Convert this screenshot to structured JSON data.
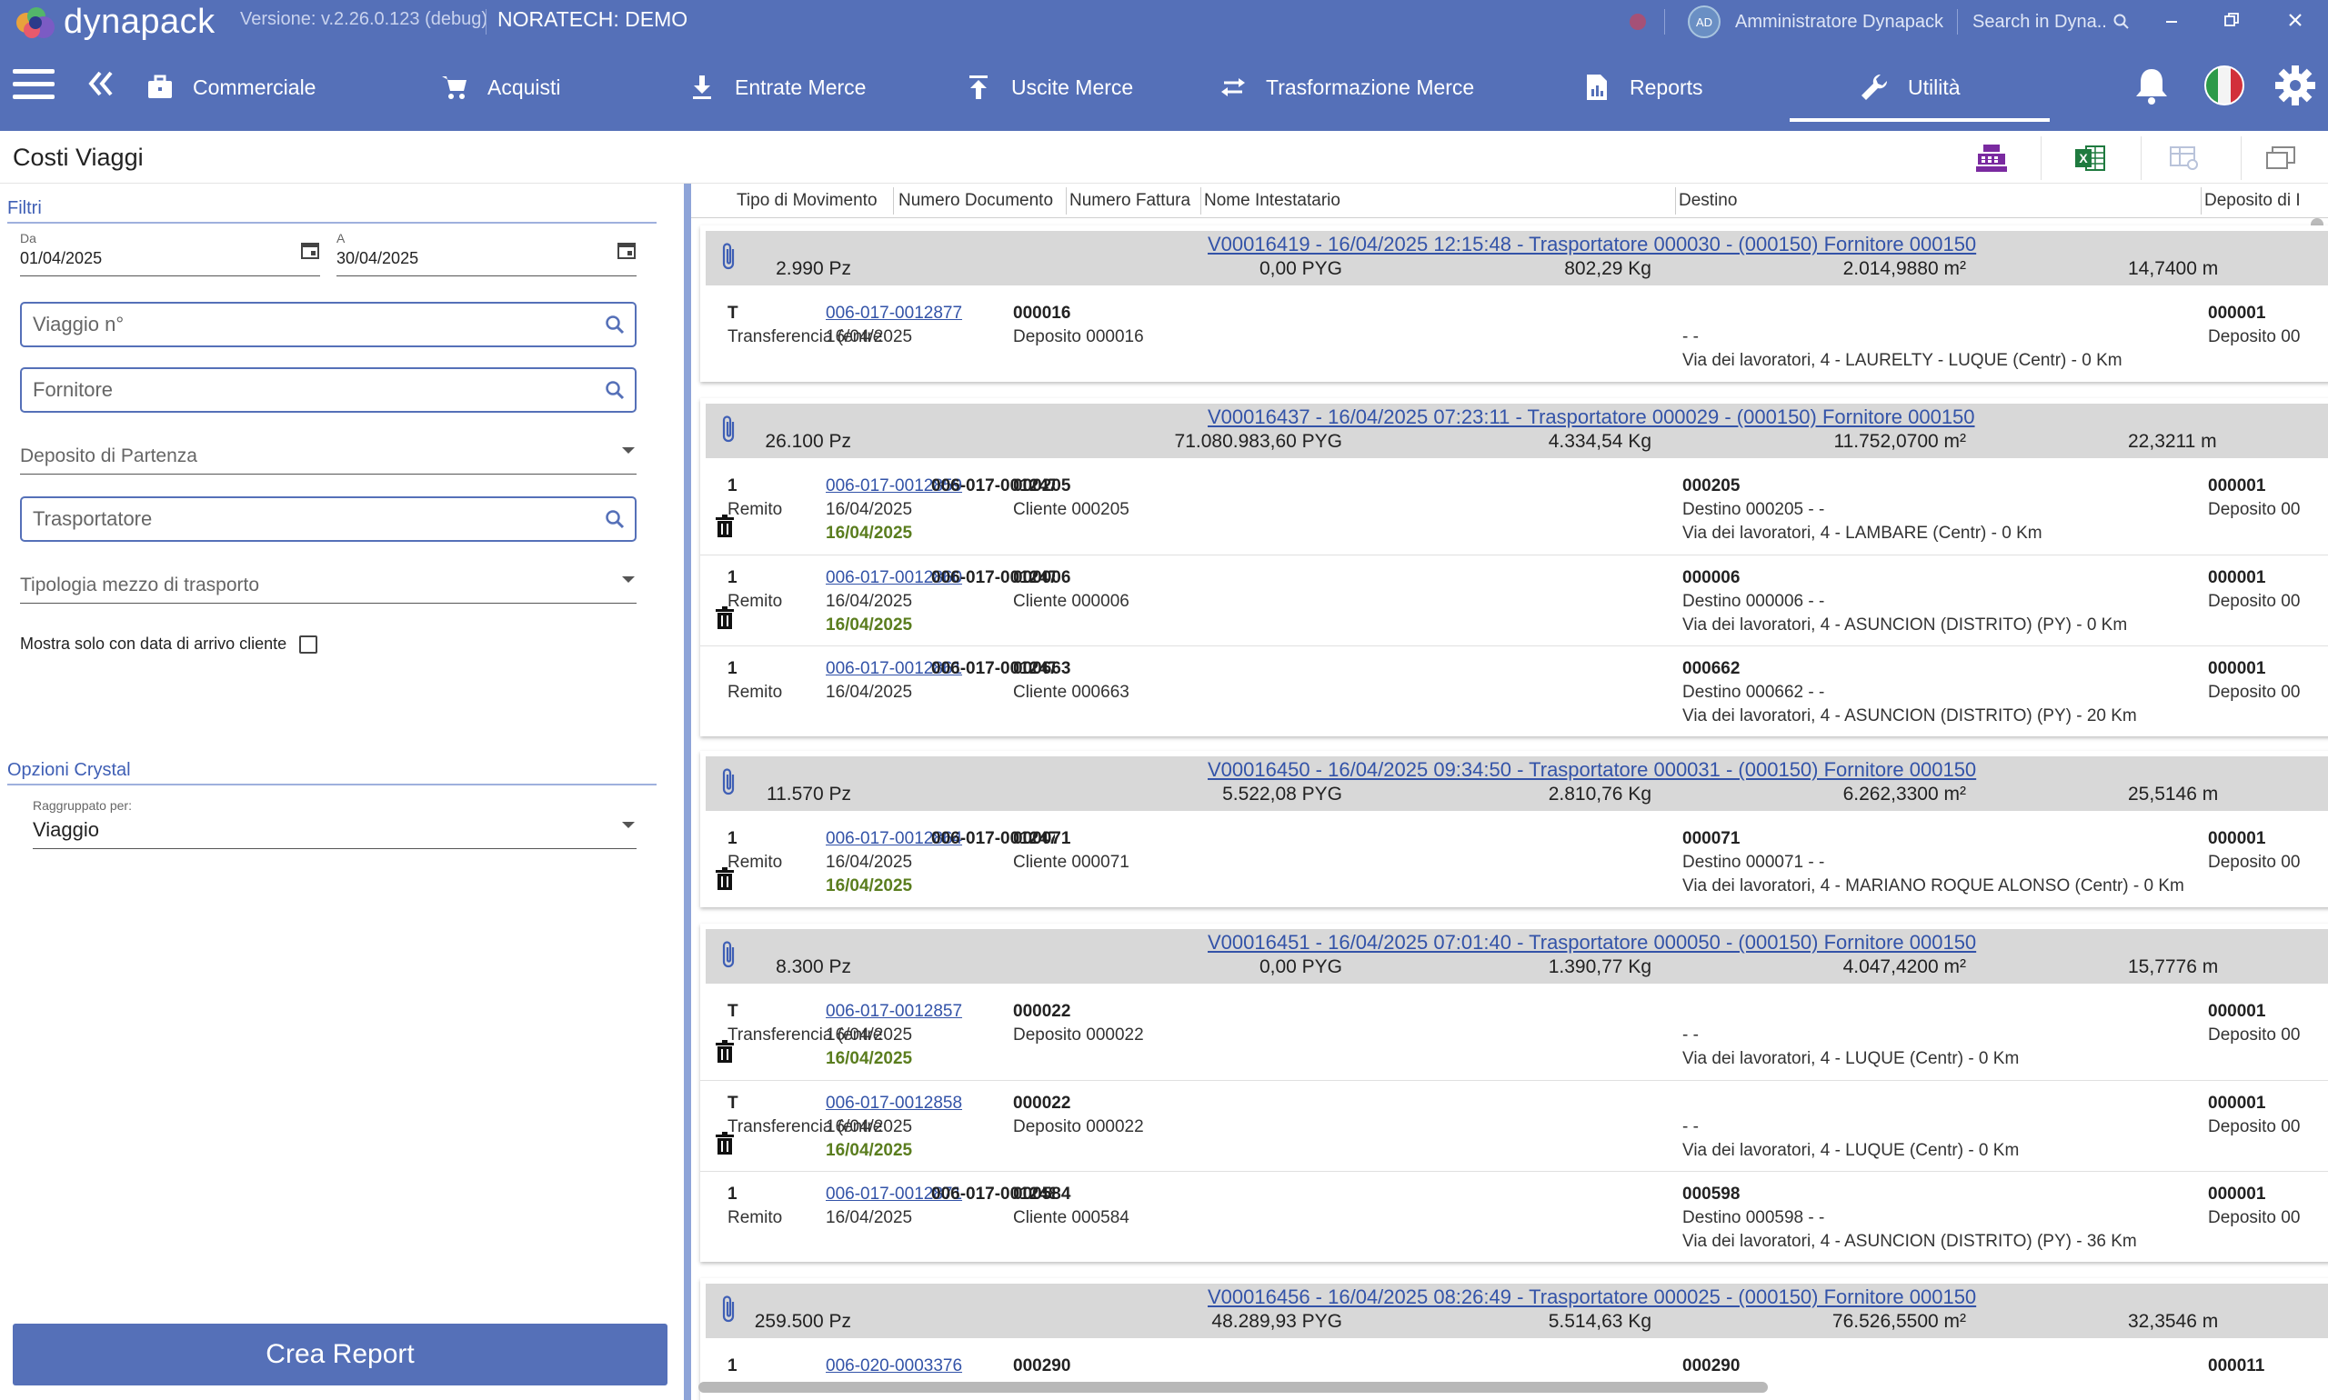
{
  "app": {
    "logo_text": "dynapack",
    "version": "Versione: v.2.26.0.123 (debug)",
    "company": "NORATECH: DEMO",
    "user_initials": "AD",
    "user_name": "Amministratore Dynapack",
    "search_placeholder": "Search in Dyna.."
  },
  "nav": {
    "items": [
      {
        "label": "Commerciale",
        "icon": "briefcase-icon"
      },
      {
        "label": "Acquisti",
        "icon": "cart-icon"
      },
      {
        "label": "Entrate Merce",
        "icon": "download-icon"
      },
      {
        "label": "Uscite Merce",
        "icon": "upload-icon"
      },
      {
        "label": "Trasformazione Merce",
        "icon": "swap-icon"
      },
      {
        "label": "Reports",
        "icon": "report-icon"
      },
      {
        "label": "Utilità",
        "icon": "wrench-icon"
      }
    ],
    "active": "Utilità"
  },
  "page": {
    "title": "Costi Viaggi"
  },
  "filters": {
    "section_title": "Filtri",
    "date_from_label": "Da",
    "date_from": "01/04/2025",
    "date_to_label": "A",
    "date_to": "30/04/2025",
    "viaggio_placeholder": "Viaggio n°",
    "fornitore_placeholder": "Fornitore",
    "deposito_placeholder": "Deposito di Partenza",
    "trasportatore_placeholder": "Trasportatore",
    "tipologia_placeholder": "Tipologia mezzo di trasporto",
    "mostra_label": "Mostra solo con data di arrivo cliente"
  },
  "crystal": {
    "section_title": "Opzioni Crystal",
    "group_label": "Raggruppato per:",
    "group_value": "Viaggio"
  },
  "create_button": "Crea Report",
  "grid": {
    "columns": [
      "Tipo di Movimento",
      "Numero Documento",
      "Numero Fattura",
      "Nome Intestatario",
      "Destino",
      "Deposito di I"
    ],
    "groups": [
      {
        "title": "V00016419 - 16/04/2025 12:15:48 - Trasportatore 000030 - (000150) Fornitore 000150",
        "pz": "2.990 Pz",
        "pyg": "0,00 PYG",
        "kg": "802,29 Kg",
        "m2": "2.014,9880 m²",
        "dep": "14,7400 m",
        "rows": [
          {
            "tipo": "T",
            "tipo2": "Transferencia (entre",
            "doc": "006-017-0012877",
            "data": "16/04/2025",
            "arrivo": "",
            "fattura": "",
            "cod": "000016",
            "nome": "Deposito 000016",
            "dest_cod": "",
            "dest_nome": "-  -",
            "via": "Via dei lavoratori, 4 - LAURELTY - LUQUE (Centr) - 0 Km",
            "depcod": "000001",
            "depnome": "Deposito 00",
            "trash": false
          }
        ]
      },
      {
        "title": "V00016437 - 16/04/2025 07:23:11 - Trasportatore 000029 - (000150) Fornitore 000150",
        "pz": "26.100 Pz",
        "pyg": "71.080.983,60 PYG",
        "kg": "4.334,54 Kg",
        "m2": "11.752,0700 m²",
        "dep": "22,3211 m",
        "rows": [
          {
            "tipo": "1",
            "tipo2": "Remito",
            "doc": "006-017-0012859",
            "data": "16/04/2025",
            "arrivo": "16/04/2025",
            "fattura": "006-017-001247",
            "cod": "000205",
            "nome": "Cliente 000205",
            "dest_cod": "000205",
            "dest_nome": "Destino 000205 -  -",
            "via": "Via dei lavoratori, 4 - LAMBARE (Centr) - 0 Km",
            "depcod": "000001",
            "depnome": "Deposito 00",
            "trash": true
          },
          {
            "tipo": "1",
            "tipo2": "Remito",
            "doc": "006-017-0012860",
            "data": "16/04/2025",
            "arrivo": "16/04/2025",
            "fattura": "006-017-001247",
            "cod": "000006",
            "nome": "Cliente 000006",
            "dest_cod": "000006",
            "dest_nome": "Destino 000006 -  -",
            "via": "Via dei lavoratori, 4 - ASUNCION (DISTRITO) (PY) - 0 Km",
            "depcod": "000001",
            "depnome": "Deposito 00",
            "trash": true
          },
          {
            "tipo": "1",
            "tipo2": "Remito",
            "doc": "006-017-0012861",
            "data": "16/04/2025",
            "arrivo": "",
            "fattura": "006-017-001247",
            "cod": "000663",
            "nome": "Cliente 000663",
            "dest_cod": "000662",
            "dest_nome": "Destino 000662 -  -",
            "via": "Via dei lavoratori, 4 - ASUNCION (DISTRITO) (PY) - 20 Km",
            "depcod": "000001",
            "depnome": "Deposito 00",
            "trash": false
          }
        ]
      },
      {
        "title": "V00016450 - 16/04/2025 09:34:50 - Trasportatore 000031 - (000150) Fornitore 000150",
        "pz": "11.570 Pz",
        "pyg": "5.522,08 PYG",
        "kg": "2.810,76 Kg",
        "m2": "6.262,3300 m²",
        "dep": "25,5146 m",
        "rows": [
          {
            "tipo": "1",
            "tipo2": "Remito",
            "doc": "006-017-0012864",
            "data": "16/04/2025",
            "arrivo": "16/04/2025",
            "fattura": "006-017-001247",
            "cod": "000071",
            "nome": "Cliente 000071",
            "dest_cod": "000071",
            "dest_nome": "Destino 000071 -  -",
            "via": "Via dei lavoratori, 4 - MARIANO ROQUE ALONSO (Centr) - 0 Km",
            "depcod": "000001",
            "depnome": "Deposito 00",
            "trash": true
          }
        ]
      },
      {
        "title": "V00016451 - 16/04/2025 07:01:40 - Trasportatore 000050 - (000150) Fornitore 000150",
        "pz": "8.300 Pz",
        "pyg": "0,00 PYG",
        "kg": "1.390,77 Kg",
        "m2": "4.047,4200 m²",
        "dep": "15,7776 m",
        "rows": [
          {
            "tipo": "T",
            "tipo2": "Transferencia (entre",
            "doc": "006-017-0012857",
            "data": "16/04/2025",
            "arrivo": "16/04/2025",
            "fattura": "",
            "cod": "000022",
            "nome": "Deposito 000022",
            "dest_cod": "",
            "dest_nome": "-  -",
            "via": "Via dei lavoratori, 4 - LUQUE (Centr) - 0 Km",
            "depcod": "000001",
            "depnome": "Deposito 00",
            "trash": true
          },
          {
            "tipo": "T",
            "tipo2": "Transferencia (entre",
            "doc": "006-017-0012858",
            "data": "16/04/2025",
            "arrivo": "16/04/2025",
            "fattura": "",
            "cod": "000022",
            "nome": "Deposito 000022",
            "dest_cod": "",
            "dest_nome": "-  -",
            "via": "Via dei lavoratori, 4 - LUQUE (Centr) - 0 Km",
            "depcod": "000001",
            "depnome": "Deposito 00",
            "trash": true
          },
          {
            "tipo": "1",
            "tipo2": "Remito",
            "doc": "006-017-0012871",
            "data": "16/04/2025",
            "arrivo": "",
            "fattura": "006-017-001248",
            "cod": "000584",
            "nome": "Cliente 000584",
            "dest_cod": "000598",
            "dest_nome": "Destino 000598 -  -",
            "via": "Via dei lavoratori, 4 - ASUNCION (DISTRITO) (PY) - 36 Km",
            "depcod": "000001",
            "depnome": "Deposito 00",
            "trash": false
          }
        ]
      },
      {
        "title": "V00016456 - 16/04/2025 08:26:49 - Trasportatore 000025 - (000150) Fornitore 000150",
        "pz": "259.500 Pz",
        "pyg": "48.289,93 PYG",
        "kg": "5.514,63 Kg",
        "m2": "76.526,5500 m²",
        "dep": "32,3546 m",
        "rows": [
          {
            "tipo": "1",
            "tipo2": "",
            "doc": "006-020-0003376",
            "data": "",
            "arrivo": "",
            "fattura": "",
            "cod": "000290",
            "nome": "",
            "dest_cod": "000290",
            "dest_nome": "",
            "via": "",
            "depcod": "000011",
            "depnome": "",
            "trash": false
          }
        ]
      }
    ]
  }
}
